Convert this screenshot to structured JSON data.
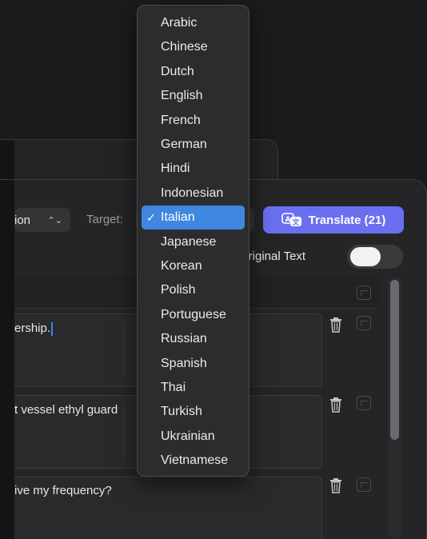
{
  "toolbar": {
    "source_value": "ion",
    "target_label": "Target:",
    "translate_label": "Translate (21)",
    "show_original_label": "w Original Text",
    "show_original_on": false
  },
  "entries": [
    {
      "text": "ership."
    },
    {
      "text": "t vessel ethyl guard"
    },
    {
      "text": "ive my frequency?"
    }
  ],
  "language_menu": {
    "selected": "Italian",
    "items": [
      "Arabic",
      "Chinese",
      "Dutch",
      "English",
      "French",
      "German",
      "Hindi",
      "Indonesian",
      "Italian",
      "Japanese",
      "Korean",
      "Polish",
      "Portuguese",
      "Russian",
      "Spanish",
      "Thai",
      "Turkish",
      "Ukrainian",
      "Vietnamese"
    ]
  },
  "colors": {
    "accent": "#6a6ff0",
    "selection": "#3f87e0"
  }
}
